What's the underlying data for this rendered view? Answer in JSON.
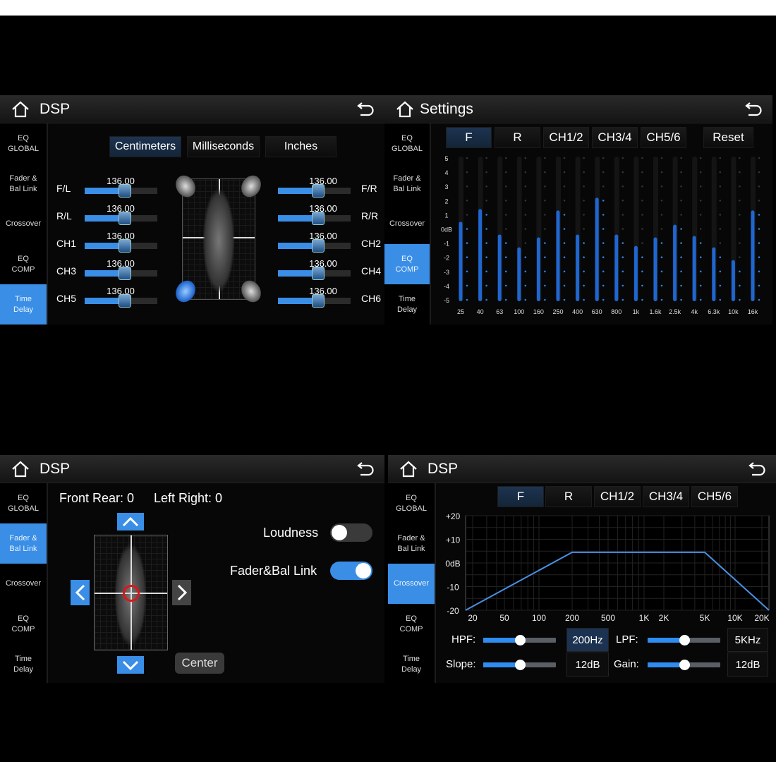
{
  "sidebar_items": [
    "EQ\nGLOBAL",
    "Fader &\nBal Link",
    "Crossover",
    "EQ\nCOMP",
    "Time\nDelay"
  ],
  "icons": {
    "home": "home-icon",
    "back": "back-arrow-icon"
  },
  "accent_color": "#3a8ee6",
  "time_delay": {
    "title": "DSP",
    "active_sidebar": 4,
    "units": [
      "Centimeters",
      "Milliseconds",
      "Inches"
    ],
    "active_unit": 0,
    "left": [
      {
        "label": "F/L",
        "value": "136.00"
      },
      {
        "label": "R/L",
        "value": "136.00"
      },
      {
        "label": "CH1",
        "value": "136.00"
      },
      {
        "label": "CH3",
        "value": "136.00"
      },
      {
        "label": "CH5",
        "value": "136.00"
      }
    ],
    "right": [
      {
        "label": "F/R",
        "value": "136.00"
      },
      {
        "label": "R/R",
        "value": "136.00"
      },
      {
        "label": "CH2",
        "value": "136.00"
      },
      {
        "label": "CH4",
        "value": "136.00"
      },
      {
        "label": "CH6",
        "value": "136.00"
      }
    ],
    "slider_fraction": 0.55,
    "selected_speaker": "rear-left"
  },
  "eq_comp": {
    "title": "Settings",
    "active_sidebar": 3,
    "tabs": [
      "F",
      "R",
      "CH1/2",
      "CH3/4",
      "CH5/6"
    ],
    "active_tab": 0,
    "reset_label": "Reset",
    "chart_data": {
      "type": "bar",
      "categories": [
        "25",
        "40",
        "63",
        "100",
        "160",
        "250",
        "400",
        "630",
        "800",
        "1k",
        "1.6k",
        "2.5k",
        "4k",
        "6.3k",
        "10k",
        "16k"
      ],
      "values": [
        0.5,
        1.4,
        -0.4,
        -1.3,
        -0.6,
        1.3,
        -0.4,
        2.2,
        -0.4,
        -1.2,
        -0.6,
        0.3,
        -0.5,
        -1.3,
        -2.2,
        1.3
      ],
      "ylim": [
        -5,
        5
      ],
      "yticks": [
        "5",
        "4",
        "3",
        "2",
        "1",
        "0dB",
        "-1",
        "-2",
        "-3",
        "-4",
        "-5"
      ]
    }
  },
  "fader": {
    "title": "DSP",
    "active_sidebar": 1,
    "front_rear": "Front Rear: 0",
    "left_right": "Left Right: 0",
    "loudness_label": "Loudness",
    "loudness_on": false,
    "link_label": "Fader&Bal Link",
    "link_on": true,
    "center_label": "Center"
  },
  "crossover": {
    "title": "DSP",
    "active_sidebar": 2,
    "tabs": [
      "F",
      "R",
      "CH1/2",
      "CH3/4",
      "CH5/6"
    ],
    "active_tab": 0,
    "chart_data": {
      "type": "line",
      "x_ticks": [
        "20",
        "50",
        "100",
        "200",
        "500",
        "1K",
        "2K",
        "5K",
        "10K",
        "20K"
      ],
      "y_ticks": [
        "+20",
        "+10",
        "0dB",
        "-10",
        "-20"
      ],
      "ylim": [
        -20,
        20
      ],
      "x": [
        20,
        200,
        5000,
        20000
      ],
      "y": [
        -20,
        4.5,
        4.5,
        -20
      ],
      "grid": true
    },
    "hpf": {
      "label": "HPF:",
      "value": "200Hz",
      "fraction": 0.5
    },
    "lpf": {
      "label": "LPF:",
      "value": "5KHz",
      "fraction": 0.5
    },
    "slope": {
      "label": "Slope:",
      "value": "12dB",
      "fraction": 0.5
    },
    "gain": {
      "label": "Gain:",
      "value": "12dB",
      "fraction": 0.5
    }
  }
}
